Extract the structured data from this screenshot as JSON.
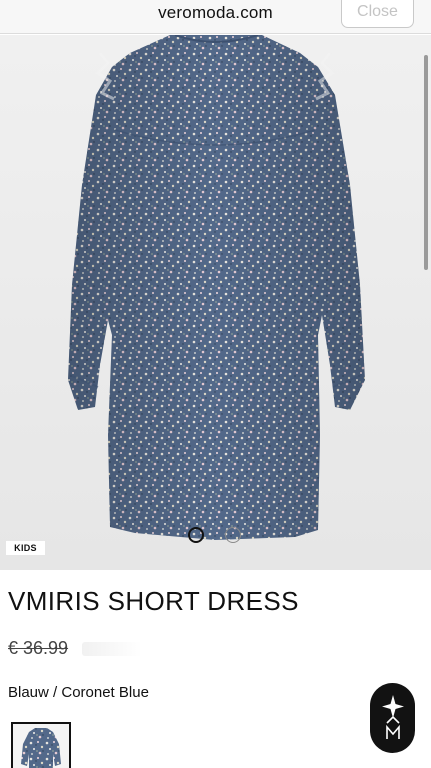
{
  "browser": {
    "url": "veromoda.com",
    "close_label": "Close"
  },
  "product": {
    "badge": "KIDS",
    "title": "VMIRIS SHORT DRESS",
    "price": "€ 36.99",
    "color": "Blauw / Coronet Blue"
  },
  "carousel": {
    "slides": 2,
    "active_index": 0
  },
  "colors": {
    "dress_base": "#51698a",
    "background": "#eaeaea",
    "accent": "#111111"
  }
}
